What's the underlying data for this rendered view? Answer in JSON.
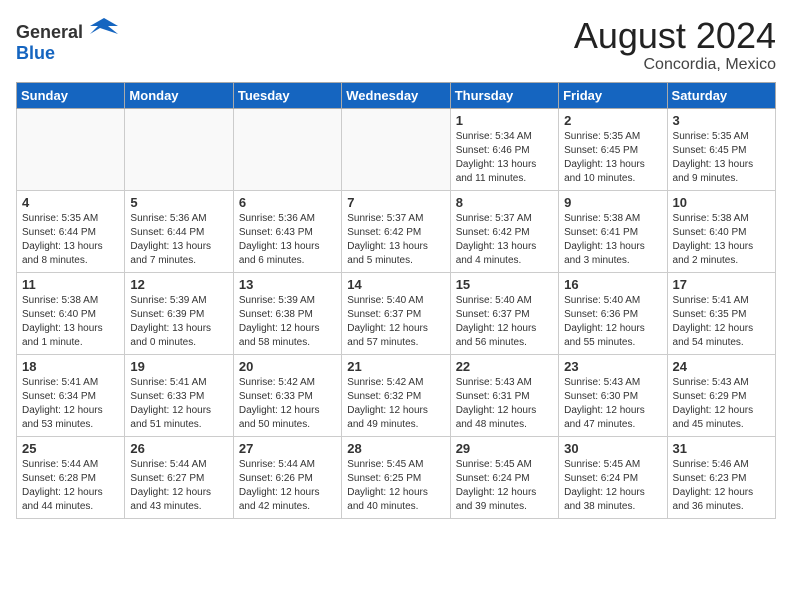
{
  "header": {
    "logo_general": "General",
    "logo_blue": "Blue",
    "month_year": "August 2024",
    "location": "Concordia, Mexico"
  },
  "days_of_week": [
    "Sunday",
    "Monday",
    "Tuesday",
    "Wednesday",
    "Thursday",
    "Friday",
    "Saturday"
  ],
  "weeks": [
    [
      {
        "day": "",
        "info": ""
      },
      {
        "day": "",
        "info": ""
      },
      {
        "day": "",
        "info": ""
      },
      {
        "day": "",
        "info": ""
      },
      {
        "day": "1",
        "info": "Sunrise: 5:34 AM\nSunset: 6:46 PM\nDaylight: 13 hours and 11 minutes."
      },
      {
        "day": "2",
        "info": "Sunrise: 5:35 AM\nSunset: 6:45 PM\nDaylight: 13 hours and 10 minutes."
      },
      {
        "day": "3",
        "info": "Sunrise: 5:35 AM\nSunset: 6:45 PM\nDaylight: 13 hours and 9 minutes."
      }
    ],
    [
      {
        "day": "4",
        "info": "Sunrise: 5:35 AM\nSunset: 6:44 PM\nDaylight: 13 hours and 8 minutes."
      },
      {
        "day": "5",
        "info": "Sunrise: 5:36 AM\nSunset: 6:44 PM\nDaylight: 13 hours and 7 minutes."
      },
      {
        "day": "6",
        "info": "Sunrise: 5:36 AM\nSunset: 6:43 PM\nDaylight: 13 hours and 6 minutes."
      },
      {
        "day": "7",
        "info": "Sunrise: 5:37 AM\nSunset: 6:42 PM\nDaylight: 13 hours and 5 minutes."
      },
      {
        "day": "8",
        "info": "Sunrise: 5:37 AM\nSunset: 6:42 PM\nDaylight: 13 hours and 4 minutes."
      },
      {
        "day": "9",
        "info": "Sunrise: 5:38 AM\nSunset: 6:41 PM\nDaylight: 13 hours and 3 minutes."
      },
      {
        "day": "10",
        "info": "Sunrise: 5:38 AM\nSunset: 6:40 PM\nDaylight: 13 hours and 2 minutes."
      }
    ],
    [
      {
        "day": "11",
        "info": "Sunrise: 5:38 AM\nSunset: 6:40 PM\nDaylight: 13 hours and 1 minute."
      },
      {
        "day": "12",
        "info": "Sunrise: 5:39 AM\nSunset: 6:39 PM\nDaylight: 13 hours and 0 minutes."
      },
      {
        "day": "13",
        "info": "Sunrise: 5:39 AM\nSunset: 6:38 PM\nDaylight: 12 hours and 58 minutes."
      },
      {
        "day": "14",
        "info": "Sunrise: 5:40 AM\nSunset: 6:37 PM\nDaylight: 12 hours and 57 minutes."
      },
      {
        "day": "15",
        "info": "Sunrise: 5:40 AM\nSunset: 6:37 PM\nDaylight: 12 hours and 56 minutes."
      },
      {
        "day": "16",
        "info": "Sunrise: 5:40 AM\nSunset: 6:36 PM\nDaylight: 12 hours and 55 minutes."
      },
      {
        "day": "17",
        "info": "Sunrise: 5:41 AM\nSunset: 6:35 PM\nDaylight: 12 hours and 54 minutes."
      }
    ],
    [
      {
        "day": "18",
        "info": "Sunrise: 5:41 AM\nSunset: 6:34 PM\nDaylight: 12 hours and 53 minutes."
      },
      {
        "day": "19",
        "info": "Sunrise: 5:41 AM\nSunset: 6:33 PM\nDaylight: 12 hours and 51 minutes."
      },
      {
        "day": "20",
        "info": "Sunrise: 5:42 AM\nSunset: 6:33 PM\nDaylight: 12 hours and 50 minutes."
      },
      {
        "day": "21",
        "info": "Sunrise: 5:42 AM\nSunset: 6:32 PM\nDaylight: 12 hours and 49 minutes."
      },
      {
        "day": "22",
        "info": "Sunrise: 5:43 AM\nSunset: 6:31 PM\nDaylight: 12 hours and 48 minutes."
      },
      {
        "day": "23",
        "info": "Sunrise: 5:43 AM\nSunset: 6:30 PM\nDaylight: 12 hours and 47 minutes."
      },
      {
        "day": "24",
        "info": "Sunrise: 5:43 AM\nSunset: 6:29 PM\nDaylight: 12 hours and 45 minutes."
      }
    ],
    [
      {
        "day": "25",
        "info": "Sunrise: 5:44 AM\nSunset: 6:28 PM\nDaylight: 12 hours and 44 minutes."
      },
      {
        "day": "26",
        "info": "Sunrise: 5:44 AM\nSunset: 6:27 PM\nDaylight: 12 hours and 43 minutes."
      },
      {
        "day": "27",
        "info": "Sunrise: 5:44 AM\nSunset: 6:26 PM\nDaylight: 12 hours and 42 minutes."
      },
      {
        "day": "28",
        "info": "Sunrise: 5:45 AM\nSunset: 6:25 PM\nDaylight: 12 hours and 40 minutes."
      },
      {
        "day": "29",
        "info": "Sunrise: 5:45 AM\nSunset: 6:24 PM\nDaylight: 12 hours and 39 minutes."
      },
      {
        "day": "30",
        "info": "Sunrise: 5:45 AM\nSunset: 6:24 PM\nDaylight: 12 hours and 38 minutes."
      },
      {
        "day": "31",
        "info": "Sunrise: 5:46 AM\nSunset: 6:23 PM\nDaylight: 12 hours and 36 minutes."
      }
    ]
  ]
}
